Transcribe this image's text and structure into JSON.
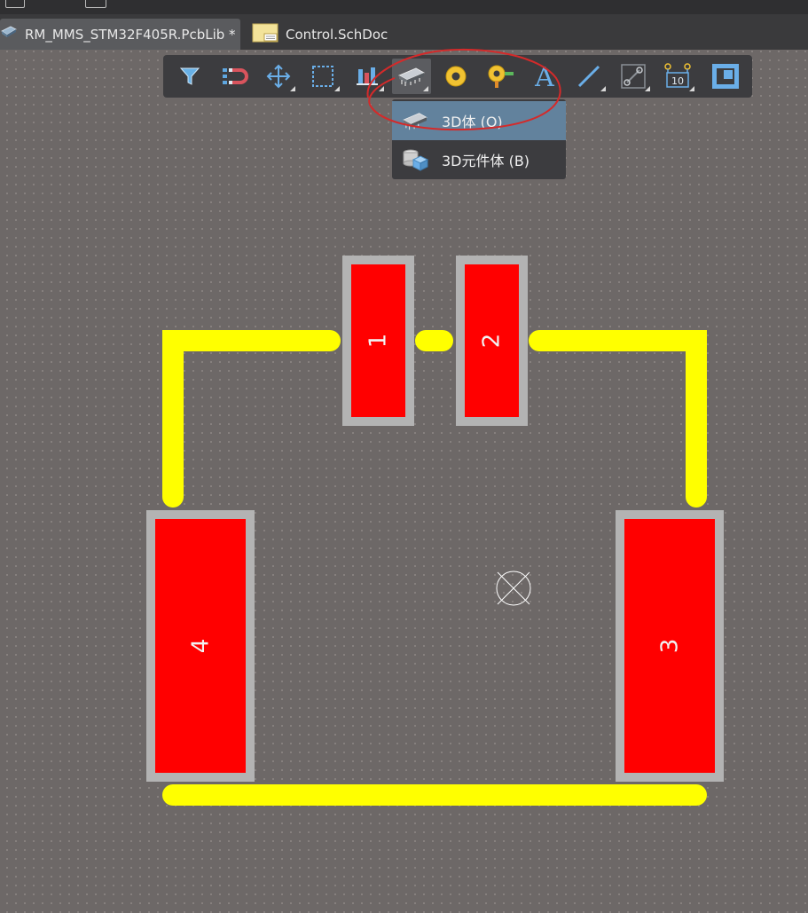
{
  "tabs": [
    {
      "label": "RM_MMS_STM32F405R.PcbLib *",
      "icon": "pcb-chip-icon",
      "active": true
    },
    {
      "label": "Control.SchDoc",
      "icon": "schematic-doc-icon",
      "active": false
    }
  ],
  "toolbar": {
    "buttons": [
      {
        "icon": "filter-icon"
      },
      {
        "icon": "interactive-route-icon"
      },
      {
        "icon": "move-icon"
      },
      {
        "icon": "select-area-icon"
      },
      {
        "icon": "align-icon"
      },
      {
        "icon": "3d-body-icon",
        "selected": true
      },
      {
        "icon": "pad-icon"
      },
      {
        "icon": "via-icon"
      },
      {
        "icon": "text-icon"
      },
      {
        "icon": "line-icon"
      },
      {
        "icon": "track-icon"
      },
      {
        "icon": "dimension-icon"
      },
      {
        "icon": "region-icon"
      }
    ]
  },
  "dropdown": {
    "items": [
      {
        "label": "3D体 (O)",
        "icon": "3d-body-icon",
        "highlighted": true
      },
      {
        "label": "3D元件体 (B)",
        "icon": "3d-component-body-icon",
        "highlighted": false
      }
    ]
  },
  "pads": [
    {
      "number": "1"
    },
    {
      "number": "2"
    },
    {
      "number": "3"
    },
    {
      "number": "4"
    }
  ],
  "colors": {
    "canvas": "#6d6867",
    "pad_fill": "#ff0000",
    "pad_border": "#b3b3b3",
    "silkscreen": "#ffff00",
    "annotation": "#d42a2a"
  }
}
